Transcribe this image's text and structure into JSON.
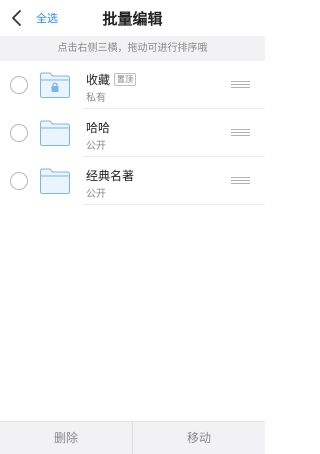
{
  "header": {
    "select_all": "全选",
    "title": "批量编辑"
  },
  "hint": "点击右侧三横，拖动可进行排序哦",
  "folders": [
    {
      "name": "收藏",
      "badge": "置顶",
      "visibility": "私有",
      "locked": true
    },
    {
      "name": "哈哈",
      "visibility": "公开",
      "locked": false
    },
    {
      "name": "经典名著",
      "visibility": "公开",
      "locked": false
    }
  ],
  "footer": {
    "delete_label": "删除",
    "move_label": "移动"
  },
  "colors": {
    "accent": "#2b8df0",
    "folder_fill": "#eaf4fd",
    "folder_stroke": "#7ab6e9",
    "hint_bg": "#f2f2f4"
  }
}
